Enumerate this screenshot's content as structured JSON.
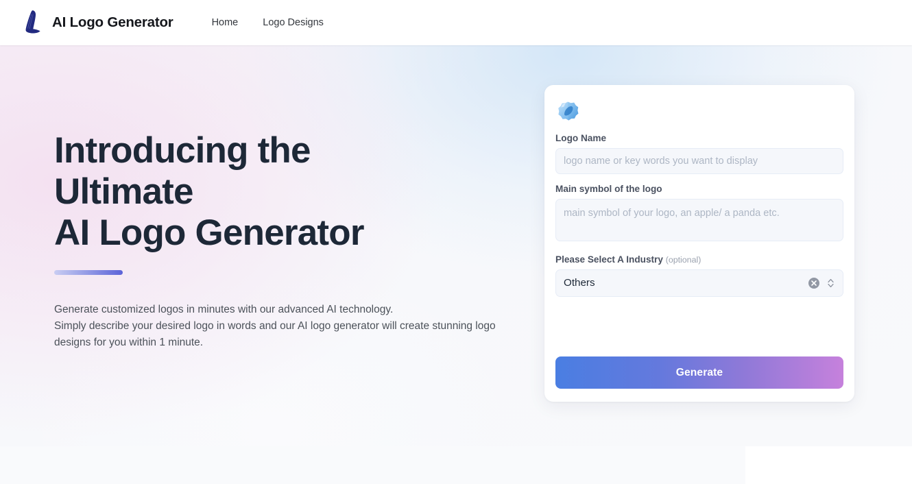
{
  "header": {
    "brand_title": "AI Logo Generator",
    "logo_icon": "stylized-letter-l-logo",
    "nav": [
      {
        "label": "Home"
      },
      {
        "label": "Logo Designs"
      }
    ]
  },
  "hero": {
    "heading_line1": "Introducing the",
    "heading_line2": "Ultimate",
    "heading_line3": "AI Logo Generator",
    "paragraph_line1": "Generate customized logos in minutes with our advanced AI technology.",
    "paragraph_line2": "Simply describe your desired logo in words and our AI logo generator will create stunning logo",
    "paragraph_line3": "designs for you within 1 minute."
  },
  "form": {
    "card_icon": "blue-gem-icon",
    "logo_name": {
      "label": "Logo Name",
      "placeholder": "logo name or key words you want to display",
      "value": ""
    },
    "main_symbol": {
      "label": "Main symbol of the logo",
      "placeholder": "main symbol of your logo, an apple/ a panda etc.",
      "value": ""
    },
    "industry": {
      "label": "Please Select A Industry",
      "optional_tag": "(optional)",
      "value": "Others",
      "clear_icon": "clear-x-icon",
      "stepper_icon": "up-down-chevron-icon"
    },
    "submit_label": "Generate"
  },
  "colors": {
    "brand_navy": "#1d2837",
    "logo_blue": "#222a80",
    "accent_bar_start": "#c9cdf2",
    "accent_bar_end": "#5b63d8",
    "button_gradient_start": "#4a7ee2",
    "button_gradient_end": "#c681dc",
    "input_bg": "#f5f7fb",
    "page_bg": "#f7f8fa"
  }
}
